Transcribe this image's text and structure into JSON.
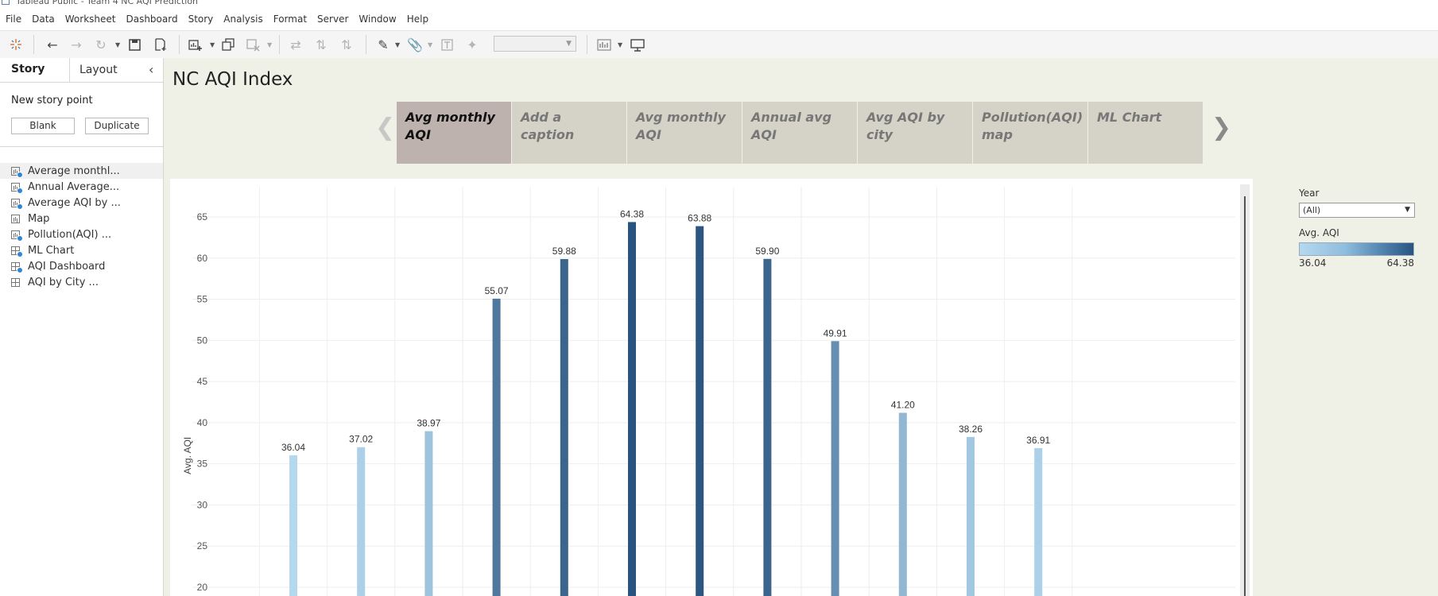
{
  "window": {
    "title": "Tableau Public - Team 4 NC AQI Prediction"
  },
  "menu": [
    "File",
    "Data",
    "Worksheet",
    "Dashboard",
    "Story",
    "Analysis",
    "Format",
    "Server",
    "Window",
    "Help"
  ],
  "left_pane": {
    "tabs": {
      "story": "Story",
      "layout": "Layout"
    },
    "new_story_point": "New story point",
    "blank_button": "Blank",
    "duplicate_button": "Duplicate",
    "sheets": [
      {
        "label": "Average monthl...",
        "icon": "worksheet-icon",
        "used": true,
        "selected": true
      },
      {
        "label": "Annual Average...",
        "icon": "worksheet-icon",
        "used": true
      },
      {
        "label": "Average AQI by ...",
        "icon": "worksheet-icon",
        "used": true
      },
      {
        "label": "Map",
        "icon": "worksheet-icon",
        "used": false
      },
      {
        "label": "Pollution(AQI) ...",
        "icon": "worksheet-icon",
        "used": true
      },
      {
        "label": "ML Chart",
        "icon": "dashboard-icon",
        "used": true
      },
      {
        "label": "AQI Dashboard",
        "icon": "dashboard-icon",
        "used": true
      },
      {
        "label": "AQI by City ...",
        "icon": "dashboard-icon",
        "used": false
      }
    ]
  },
  "story": {
    "title": "NC AQI Index",
    "points": [
      {
        "line1": "Avg monthly",
        "line2": "AQI",
        "active": true
      },
      {
        "line1": "Add a caption",
        "line2": ""
      },
      {
        "line1": "Avg monthly",
        "line2": "AQI"
      },
      {
        "line1": "Annual avg",
        "line2": "AQI"
      },
      {
        "line1": "Avg AQI by",
        "line2": "city"
      },
      {
        "line1": "Pollution(AQI)",
        "line2": "map"
      },
      {
        "line1": "ML Chart",
        "line2": ""
      }
    ]
  },
  "filter": {
    "label": "Year",
    "value": "(All)"
  },
  "color_legend": {
    "label": "Avg. AQI",
    "min": "36.04",
    "max": "64.38",
    "color_low": "#b4d9ef",
    "color_high": "#2a5480"
  },
  "chart_data": {
    "type": "bar",
    "ylabel": "Avg. AQI",
    "ylim": [
      20,
      67
    ],
    "yticks": [
      20,
      25,
      30,
      35,
      40,
      45,
      50,
      55,
      60,
      65
    ],
    "values": [
      36.04,
      37.02,
      38.97,
      55.07,
      59.88,
      64.38,
      63.88,
      59.9,
      49.91,
      41.2,
      38.26,
      36.91
    ],
    "labels": [
      "36.04",
      "37.02",
      "38.97",
      "55.07",
      "59.88",
      "64.38",
      "63.88",
      "59.90",
      "49.91",
      "41.20",
      "38.26",
      "36.91"
    ],
    "grid": true
  }
}
